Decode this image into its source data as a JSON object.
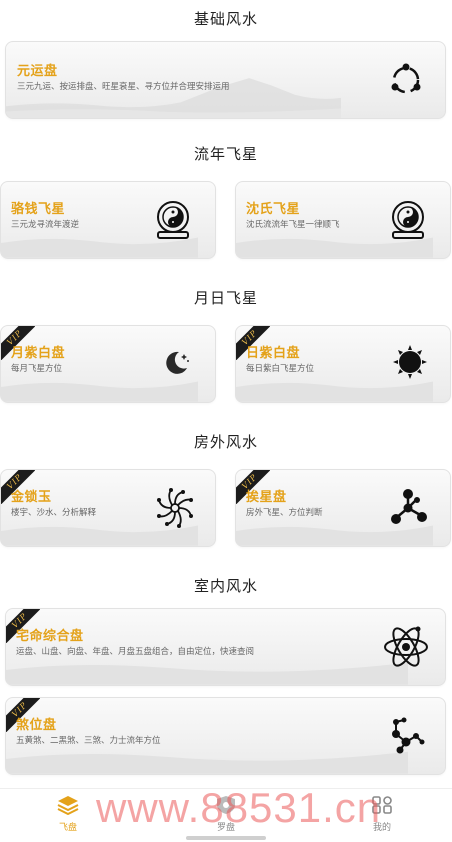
{
  "sections": {
    "basic": "基础风水",
    "flying": "流年飞星",
    "daily": "月日飞星",
    "outdoor": "房外风水",
    "indoor": "室内风水"
  },
  "vip_label": "VIP",
  "cards": {
    "yuanyun": {
      "title": "元运盘",
      "desc": "三元九运、按运排盘、旺星衰星、寻方位并合理安排运用"
    },
    "luoqian": {
      "title": "骆钱飞星",
      "desc": "三元龙寻流年渡逆"
    },
    "shenshi": {
      "title": "沈氏飞星",
      "desc": "沈氏流流年飞星一律顺飞"
    },
    "yuezi": {
      "title": "月紫白盘",
      "desc": "每月飞星方位"
    },
    "rizi": {
      "title": "日紫白盘",
      "desc": "每日紫白飞星方位"
    },
    "jinsuoyu": {
      "title": "金锁玉",
      "desc": "楼宇、沙水、分析解释"
    },
    "huanxing": {
      "title": "挨星盘",
      "desc": "房外飞星、方位判断"
    },
    "zhaiming": {
      "title": "宅命综合盘",
      "desc": "运盘、山盘、向盘、年盘、月盘五盘组合，自由定位，快速查阅"
    },
    "shawei": {
      "title": "煞位盘",
      "desc": "五黄煞、二黑煞、三煞、力士流年方位"
    }
  },
  "tabbar": {
    "feipan": "飞盘",
    "luopan": "罗盘",
    "mine": "我的"
  },
  "watermark": "www.88531.cn",
  "colors": {
    "accent": "#e4a21a",
    "vip_bg": "#1c1c1c"
  }
}
